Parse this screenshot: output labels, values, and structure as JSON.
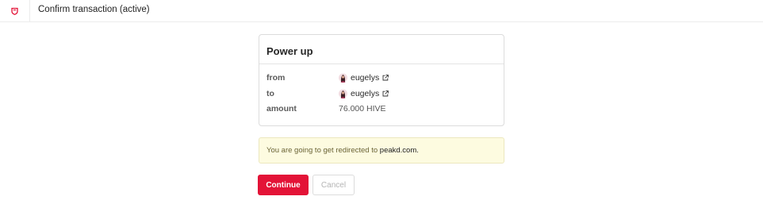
{
  "header": {
    "logo_icon": "hive-keychain-logo-icon",
    "title": "Confirm transaction (active)"
  },
  "operation": {
    "title": "Power up",
    "rows": [
      {
        "label": "from",
        "value": "eugelys",
        "has_avatar": true,
        "external_link_icon": "external-link-icon"
      },
      {
        "label": "to",
        "value": "eugelys",
        "has_avatar": true,
        "external_link_icon": "external-link-icon"
      },
      {
        "label": "amount",
        "value": "76.000 HIVE"
      }
    ]
  },
  "notice": {
    "text": "You are going to get redirected to ",
    "domain": "peakd.com."
  },
  "buttons": {
    "continue": "Continue",
    "cancel": "Cancel"
  },
  "colors": {
    "accent": "#e31337",
    "notice_bg": "#fdfbe0"
  }
}
